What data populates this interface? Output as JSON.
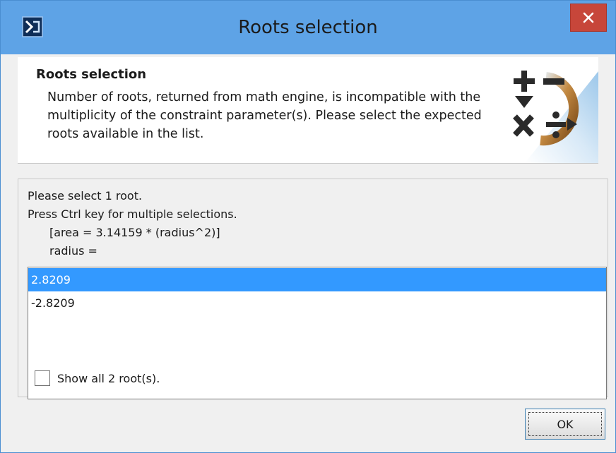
{
  "window": {
    "title": "Roots selection",
    "icons": {
      "app": "app-icon",
      "close": "close-icon"
    },
    "colors": {
      "titlebar": "#5ea3e6",
      "close": "#c7463a",
      "selection": "#3399ff"
    }
  },
  "header": {
    "title": "Roots selection",
    "description": "Number of roots, returned from math engine, is incompatible with the multiplicity of the constraint parameter(s). Please select the expected roots available in the list.",
    "icon": "math-operations-icon"
  },
  "content": {
    "instructions": [
      "Please select 1 root.",
      "Press Ctrl key for multiple selections.",
      "[area = 3.14159 * (radius^2)]",
      "radius ="
    ],
    "roots": [
      {
        "value": "2.8209",
        "selected": true
      },
      {
        "value": "-2.8209",
        "selected": false
      }
    ],
    "show_all": {
      "label": "Show all 2 root(s).",
      "checked": false
    }
  },
  "footer": {
    "ok_label": "OK"
  }
}
